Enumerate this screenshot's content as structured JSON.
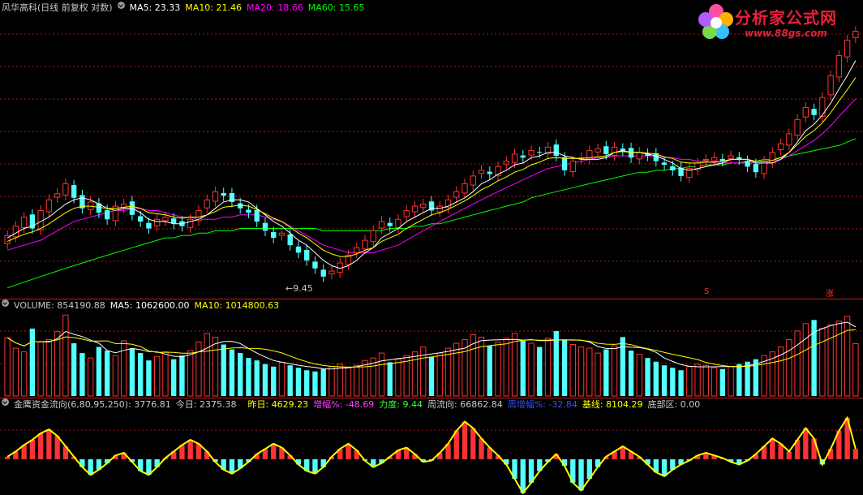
{
  "header": {
    "title": "风华高科(日线 前复权 对数)",
    "ma5": "MA5: 23.33",
    "ma10": "MA10: 21.46",
    "ma20": "MA20: 18.66",
    "ma60": "MA60: 15.65",
    "low_label": "←9.45",
    "marker_s": "S",
    "marker_zhang": "涨"
  },
  "volume_header": {
    "title": "VOLUME: 854190.88",
    "ma5": "MA5: 1062600.00",
    "ma10": "MA10: 1014800.63"
  },
  "indicator_header": {
    "title": "金鹰资金流向(6,80,95,250)",
    "value": ": 3776.81",
    "today": "今日: 2375.38",
    "yesterday": "昨日: 4629.23",
    "change": "增幅%: -48.69",
    "force": "力度: 9.44",
    "weekly": "周流向: 66862.84",
    "weekly_change": "周增幅%: -32.84",
    "baseline": "基线: 8104.29",
    "bottom": "底部区: 0.00"
  },
  "logo": {
    "text": "分析家公式网",
    "url": "www.88gs.com"
  },
  "colors": {
    "up": "#ff3232",
    "down": "#54ffff",
    "ma5": "#ffffff",
    "ma10": "#ffff00",
    "ma20": "#ff00ff",
    "ma60": "#00ff00",
    "grid": "#b01818",
    "flow_line": "#ffff00"
  },
  "chart_data": [
    {
      "type": "candlestick",
      "title": "风华高科(日线 前复权 对数)",
      "annotations": [
        "←9.45"
      ],
      "ma_last": {
        "MA5": 23.33,
        "MA10": 21.46,
        "MA20": 18.66,
        "MA60": 15.65
      },
      "close": [
        11.2,
        11.6,
        12.0,
        11.5,
        12.3,
        12.8,
        13.1,
        13.6,
        12.9,
        12.4,
        12.7,
        12.2,
        11.9,
        12.5,
        12.6,
        12.1,
        11.8,
        11.5,
        11.9,
        12.0,
        11.7,
        11.6,
        11.9,
        12.3,
        12.8,
        13.2,
        13.0,
        12.7,
        12.4,
        12.2,
        11.8,
        11.4,
        11.1,
        11.3,
        10.8,
        10.5,
        10.2,
        9.9,
        9.6,
        9.8,
        10.1,
        10.4,
        10.7,
        11.0,
        11.4,
        11.8,
        11.6,
        11.9,
        12.3,
        12.5,
        12.6,
        12.3,
        12.5,
        12.8,
        13.2,
        13.6,
        14.0,
        14.3,
        14.1,
        14.5,
        14.8,
        15.2,
        15.0,
        15.4,
        15.3,
        15.6,
        15.1,
        14.3,
        14.8,
        15.0,
        15.4,
        15.5,
        15.2,
        15.6,
        15.4,
        15.0,
        15.3,
        15.1,
        14.8,
        14.6,
        14.3,
        14.0,
        14.4,
        14.7,
        14.9,
        15.0,
        14.8,
        15.1,
        14.9,
        14.5,
        14.2,
        14.8,
        15.3,
        15.8,
        16.4,
        17.3,
        18.1,
        17.6,
        18.8,
        20.4,
        22.0,
        23.3,
        24.1
      ],
      "ma5": [
        11.1,
        11.3,
        11.5,
        11.6,
        11.8,
        12.0,
        12.3,
        12.6,
        12.8,
        12.9,
        12.8,
        12.6,
        12.4,
        12.3,
        12.4,
        12.4,
        12.2,
        11.9,
        11.8,
        11.8,
        11.7,
        11.7,
        11.8,
        11.9,
        12.1,
        12.4,
        12.7,
        12.8,
        12.8,
        12.7,
        12.4,
        12.1,
        11.8,
        11.6,
        11.3,
        11.0,
        10.8,
        10.5,
        10.2,
        10.0,
        9.9,
        10.0,
        10.2,
        10.5,
        10.7,
        11.1,
        11.3,
        11.5,
        11.8,
        12.0,
        12.2,
        12.4,
        12.4,
        12.5,
        12.7,
        12.9,
        13.2,
        13.6,
        13.8,
        14.1,
        14.3,
        14.6,
        14.7,
        15.0,
        15.1,
        15.3,
        15.3,
        15.1,
        15.0,
        14.9,
        14.9,
        14.9,
        15.0,
        15.3,
        15.4,
        15.3,
        15.3,
        15.2,
        15.1,
        14.9,
        14.7,
        14.4,
        14.3,
        14.4,
        14.5,
        14.6,
        14.7,
        14.9,
        14.9,
        14.9,
        14.7,
        14.7,
        14.7,
        14.9,
        15.3,
        15.9,
        16.6,
        17.0,
        17.6,
        18.4,
        19.4,
        20.4,
        21.6
      ],
      "ma20": [
        10.6,
        10.7,
        10.8,
        10.9,
        11.0,
        11.2,
        11.4,
        11.6,
        11.8,
        11.9,
        12.0,
        12.1,
        12.2,
        12.3,
        12.3,
        12.4,
        12.4,
        12.3,
        12.3,
        12.2,
        12.1,
        12.0,
        12.0,
        11.9,
        11.9,
        11.9,
        12.0,
        12.0,
        12.1,
        12.1,
        12.1,
        12.0,
        11.9,
        11.8,
        11.6,
        11.4,
        11.2,
        11.0,
        10.8,
        10.7,
        10.6,
        10.5,
        10.5,
        10.5,
        10.5,
        10.6,
        10.7,
        10.8,
        11.0,
        11.2,
        11.4,
        11.6,
        11.8,
        12.0,
        12.2,
        12.4,
        12.6,
        12.8,
        13.0,
        13.2,
        13.4,
        13.6,
        13.8,
        14.0,
        14.2,
        14.4,
        14.5,
        14.6,
        14.7,
        14.8,
        14.9,
        15.0,
        15.0,
        15.1,
        15.1,
        15.1,
        15.1,
        15.1,
        15.1,
        15.0,
        15.0,
        14.9,
        14.9,
        14.8,
        14.8,
        14.7,
        14.7,
        14.7,
        14.7,
        14.7,
        14.7,
        14.7,
        14.8,
        14.9,
        15.1,
        15.4,
        15.7,
        16.0,
        16.4,
        16.9,
        17.5,
        18.1,
        18.7
      ],
      "ma60": [
        9.2,
        9.3,
        9.4,
        9.5,
        9.6,
        9.7,
        9.8,
        9.9,
        10.0,
        10.1,
        10.2,
        10.3,
        10.4,
        10.5,
        10.6,
        10.7,
        10.8,
        10.9,
        11.0,
        11.1,
        11.1,
        11.2,
        11.2,
        11.3,
        11.3,
        11.4,
        11.4,
        11.4,
        11.5,
        11.5,
        11.5,
        11.5,
        11.5,
        11.5,
        11.5,
        11.5,
        11.5,
        11.5,
        11.4,
        11.4,
        11.4,
        11.4,
        11.4,
        11.4,
        11.4,
        11.4,
        11.5,
        11.5,
        11.5,
        11.6,
        11.6,
        11.7,
        11.7,
        11.8,
        11.9,
        12.0,
        12.1,
        12.2,
        12.3,
        12.4,
        12.5,
        12.6,
        12.7,
        12.9,
        13.0,
        13.1,
        13.2,
        13.3,
        13.4,
        13.5,
        13.6,
        13.7,
        13.8,
        13.9,
        14.0,
        14.1,
        14.2,
        14.2,
        14.3,
        14.3,
        14.4,
        14.4,
        14.5,
        14.5,
        14.6,
        14.6,
        14.6,
        14.7,
        14.7,
        14.8,
        14.8,
        14.9,
        14.9,
        15.0,
        15.1,
        15.2,
        15.3,
        15.4,
        15.5,
        15.6,
        15.7,
        15.9,
        16.1
      ]
    },
    {
      "type": "bar",
      "title": "VOLUME: 854190.88",
      "series": [
        {
          "name": "VOLUME",
          "values": [
            0.95,
            0.78,
            0.72,
            1.1,
            0.88,
            0.92,
            1.05,
            1.32,
            0.86,
            0.7,
            0.62,
            0.8,
            0.74,
            0.66,
            0.9,
            0.78,
            0.7,
            0.58,
            0.64,
            0.72,
            0.6,
            0.66,
            0.74,
            0.88,
            1.02,
            0.96,
            0.84,
            0.76,
            0.7,
            0.62,
            0.58,
            0.52,
            0.48,
            0.55,
            0.5,
            0.46,
            0.42,
            0.4,
            0.44,
            0.48,
            0.52,
            0.46,
            0.5,
            0.58,
            0.62,
            0.7,
            0.55,
            0.6,
            0.66,
            0.72,
            0.8,
            0.64,
            0.7,
            0.78,
            0.86,
            0.92,
            1.0,
            0.96,
            0.82,
            0.88,
            0.94,
            1.02,
            0.9,
            0.86,
            0.8,
            0.94,
            1.06,
            0.92,
            0.84,
            0.8,
            0.78,
            0.7,
            0.76,
            0.82,
            0.96,
            0.74,
            0.68,
            0.62,
            0.56,
            0.5,
            0.46,
            0.42,
            0.48,
            0.52,
            0.5,
            0.46,
            0.44,
            0.48,
            0.52,
            0.56,
            0.6,
            0.66,
            0.72,
            0.8,
            0.92,
            1.06,
            1.18,
            1.24,
            1.1,
            1.16,
            1.22,
            1.3,
            0.854
          ]
        }
      ]
    },
    {
      "type": "bar",
      "title": "金鹰资金流向(6,80,95,250)",
      "series": [
        {
          "name": "金鹰资金流向",
          "values": [
            0.2,
            0.6,
            1.1,
            1.5,
            2.0,
            2.3,
            1.8,
            1.0,
            0.2,
            -0.6,
            -1.2,
            -0.8,
            -0.3,
            0.3,
            0.5,
            -0.2,
            -0.9,
            -1.2,
            -0.6,
            0.1,
            0.6,
            1.1,
            1.5,
            1.2,
            0.6,
            -0.2,
            -0.8,
            -1.1,
            -0.7,
            -0.2,
            0.4,
            0.8,
            1.2,
            0.9,
            0.3,
            -0.4,
            -0.9,
            -1.1,
            -0.6,
            0.2,
            0.8,
            1.2,
            0.7,
            -0.1,
            -0.6,
            -0.3,
            0.2,
            0.7,
            0.9,
            0.4,
            -0.2,
            -0.1,
            0.5,
            1.2,
            2.2,
            2.9,
            2.4,
            1.6,
            0.9,
            0.3,
            -0.4,
            -1.5,
            -2.6,
            -1.8,
            -0.9,
            -0.2,
            0.4,
            -0.5,
            -1.8,
            -2.4,
            -1.5,
            -0.6,
            0.2,
            0.6,
            1.0,
            0.6,
            0.2,
            -0.4,
            -1.0,
            -1.3,
            -0.8,
            -0.4,
            -0.1,
            0.3,
            0.5,
            0.3,
            0.1,
            -0.2,
            -0.4,
            -0.1,
            0.4,
            1.0,
            1.6,
            1.2,
            0.6,
            1.5,
            2.4,
            1.6,
            -0.4,
            0.8,
            2.2,
            3.2,
            0.8
          ]
        }
      ]
    }
  ]
}
